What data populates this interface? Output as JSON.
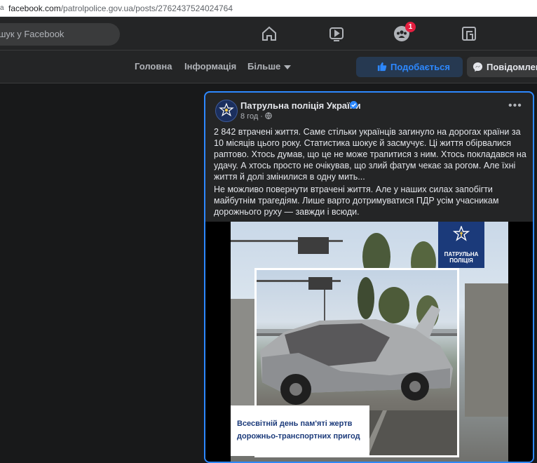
{
  "browser": {
    "url_host": "facebook.com",
    "url_path": "/patrolpolice.gov.ua/posts/2762437524024764"
  },
  "topbar": {
    "search_placeholder": "шук у Facebook",
    "notifications_badge": "1"
  },
  "page_tabs": {
    "home": "Головна",
    "info": "Інформація",
    "more": "Більше",
    "like_button": "Подобається",
    "message_button": "Повідомлення"
  },
  "post": {
    "page_name": "Патрульна поліція України",
    "time": "8 год",
    "paragraph1": "2 842 втрачені життя. Саме стільки українців загинуло на дорогах країни за 10 місяців цього року. Статистика шокує й засмучує. Ці життя обірвалися раптово. Хтось думав, що це не може трапитися з ним. Хтось покладався на удачу. А хтось просто не очікував, що злий фатум чекає за рогом. Але їхні життя й долі змінилися в одну мить...",
    "paragraph2": "Не можливо повернути втрачені життя. Але у наших силах запобігти майбутнім трагедіям. Лише варто дотримуватися ПДР усім учасникам дорожнього руху — завжди і всюди."
  },
  "image": {
    "logo_line1": "ПАТРУЛЬНА",
    "logo_line2": "ПОЛІЦІЯ",
    "caption_line1": "Всесвітній день пам'яті жертв",
    "caption_line2": "дорожньо-транспортних пригод"
  },
  "colors": {
    "accent": "#2d88ff",
    "background": "#18191a",
    "surface": "#242526",
    "badge": "#e41e3f",
    "police_blue": "#1b3a7a"
  },
  "icons": [
    "lock-icon",
    "home-icon",
    "watch-icon",
    "groups-icon",
    "gaming-icon",
    "like-icon",
    "messenger-icon",
    "verified-icon",
    "globe-icon",
    "more-icon",
    "police-star-icon"
  ]
}
